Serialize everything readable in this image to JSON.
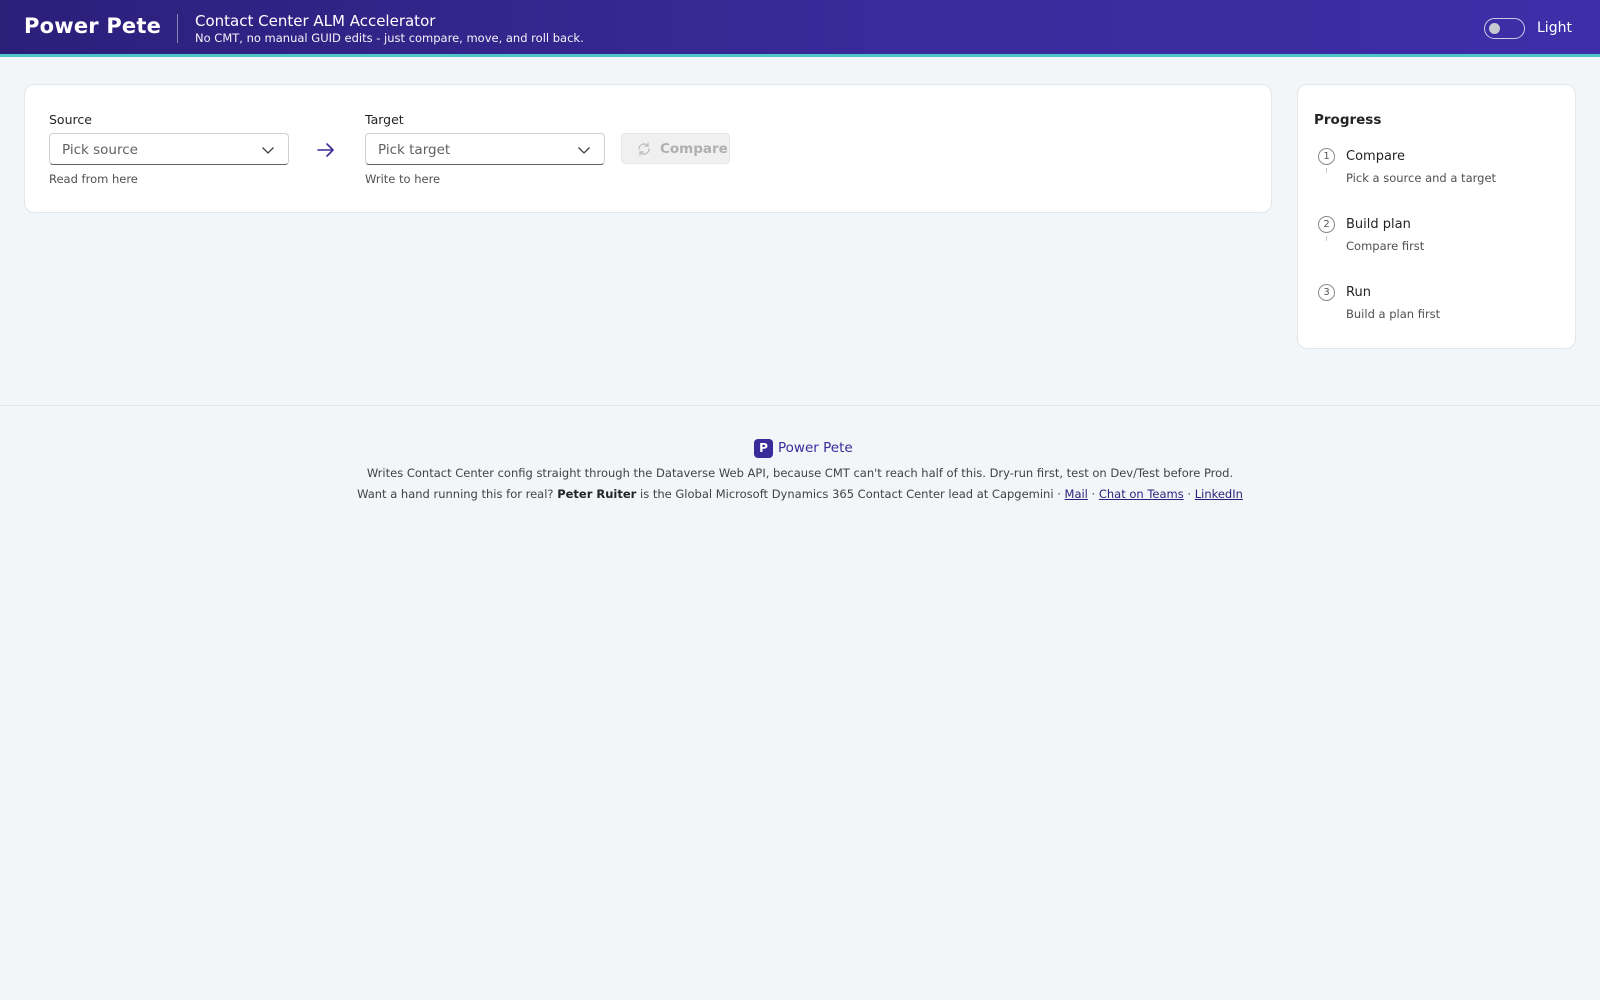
{
  "header": {
    "brand": "Power Pete",
    "title": "Contact Center ALM Accelerator",
    "subtitle": "No CMT, no manual GUID edits - just compare, move, and roll back.",
    "theme_label": "Light"
  },
  "selector": {
    "source": {
      "label": "Source",
      "placeholder": "Pick source",
      "hint": "Read from here"
    },
    "target": {
      "label": "Target",
      "placeholder": "Pick target",
      "hint": "Write to here"
    },
    "compare_label": "Compare"
  },
  "progress": {
    "title": "Progress",
    "steps": [
      {
        "num": "1",
        "title": "Compare",
        "sub": "Pick a source and a target"
      },
      {
        "num": "2",
        "title": "Build plan",
        "sub": "Compare first"
      },
      {
        "num": "3",
        "title": "Run",
        "sub": "Build a plan first"
      }
    ]
  },
  "footer": {
    "logo_letter": "P",
    "brand": "Power Pete",
    "line1": "Writes Contact Center config straight through the Dataverse Web API, because CMT can't reach half of this. Dry-run first, test on Dev/Test before Prod.",
    "line2_prefix": "Want a hand running this for real?",
    "person": "Peter Ruiter",
    "line2_mid": "is the Global Microsoft Dynamics 365 Contact Center lead at Capgemini ·",
    "sep": "·",
    "links": {
      "mail": "Mail",
      "teams": "Chat on Teams",
      "linkedin": "LinkedIn"
    }
  },
  "colors": {
    "header_bg": "#3a2a9a",
    "accent_line": "#4fc6c8",
    "page_bg": "#f3f6f9",
    "card_bg": "#ffffff",
    "brand_purple": "#3a2a9a"
  },
  "icons": {
    "toggle": "toggle-off-icon",
    "chevron": "chevron-down-icon",
    "arrow": "arrow-right-icon",
    "compare": "sync-icon"
  }
}
